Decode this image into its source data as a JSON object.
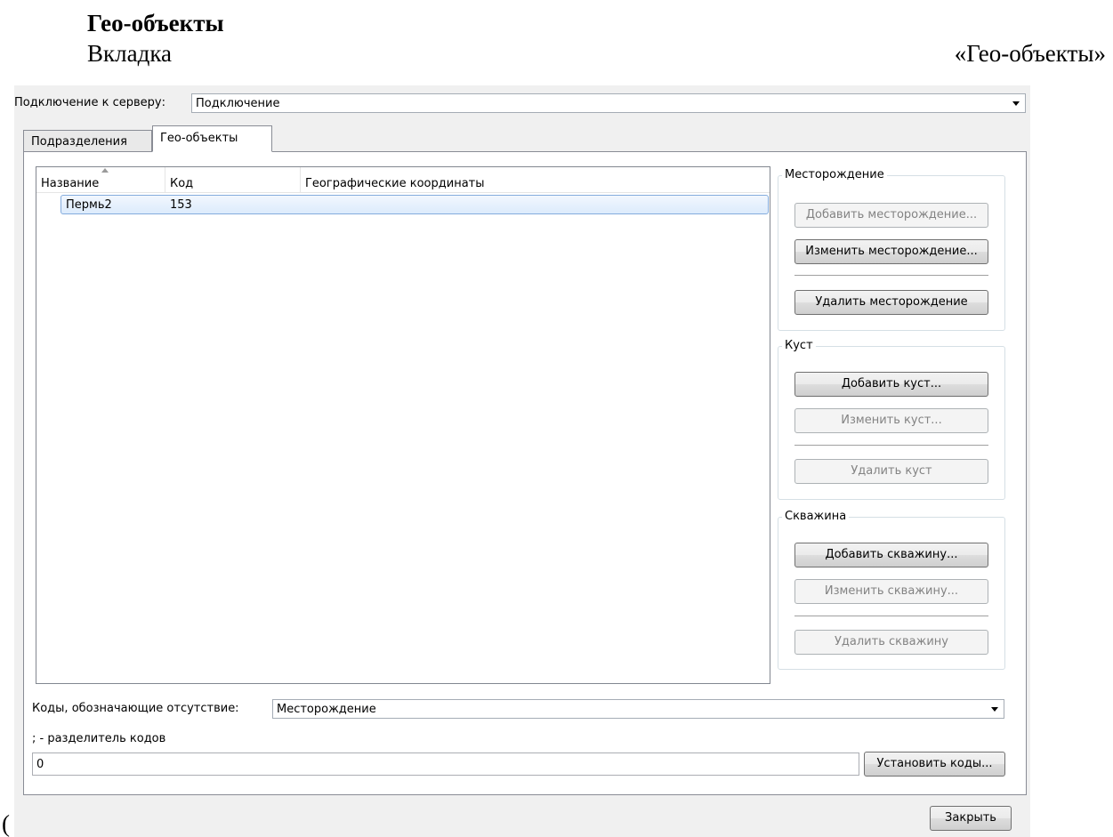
{
  "document": {
    "heading": "Гео-объекты",
    "line_left": "Вкладка",
    "line_right": "«Гео-объекты»",
    "fragment": "("
  },
  "window": {
    "server_label": "Подключение к серверу:",
    "server_value": "Подключение",
    "tabs": [
      {
        "label": "Подразделения",
        "active": false
      },
      {
        "label": "Гео-объекты",
        "active": true
      }
    ],
    "list": {
      "columns": [
        "Название",
        "Код",
        "Географические координаты"
      ],
      "sort_column": "Название",
      "rows": [
        {
          "name": "Пермь2",
          "code": "153",
          "coords": ""
        }
      ]
    },
    "groups": {
      "field": {
        "title": "Месторождение",
        "add": "Добавить месторождение...",
        "edit": "Изменить месторождение...",
        "delete": "Удалить месторождение"
      },
      "pad": {
        "title": "Куст",
        "add": "Добавить куст...",
        "edit": "Изменить куст...",
        "delete": "Удалить куст"
      },
      "well": {
        "title": "Скважина",
        "add": "Добавить скважину...",
        "edit": "Изменить скважину...",
        "delete": "Удалить скважину"
      }
    },
    "codes_label": "Коды, обозначающие отсутствие:",
    "codes_select": "Месторождение",
    "separator_hint": "; - разделитель кодов",
    "codes_value": "0",
    "set_codes": "Установить коды...",
    "close": "Закрыть"
  }
}
